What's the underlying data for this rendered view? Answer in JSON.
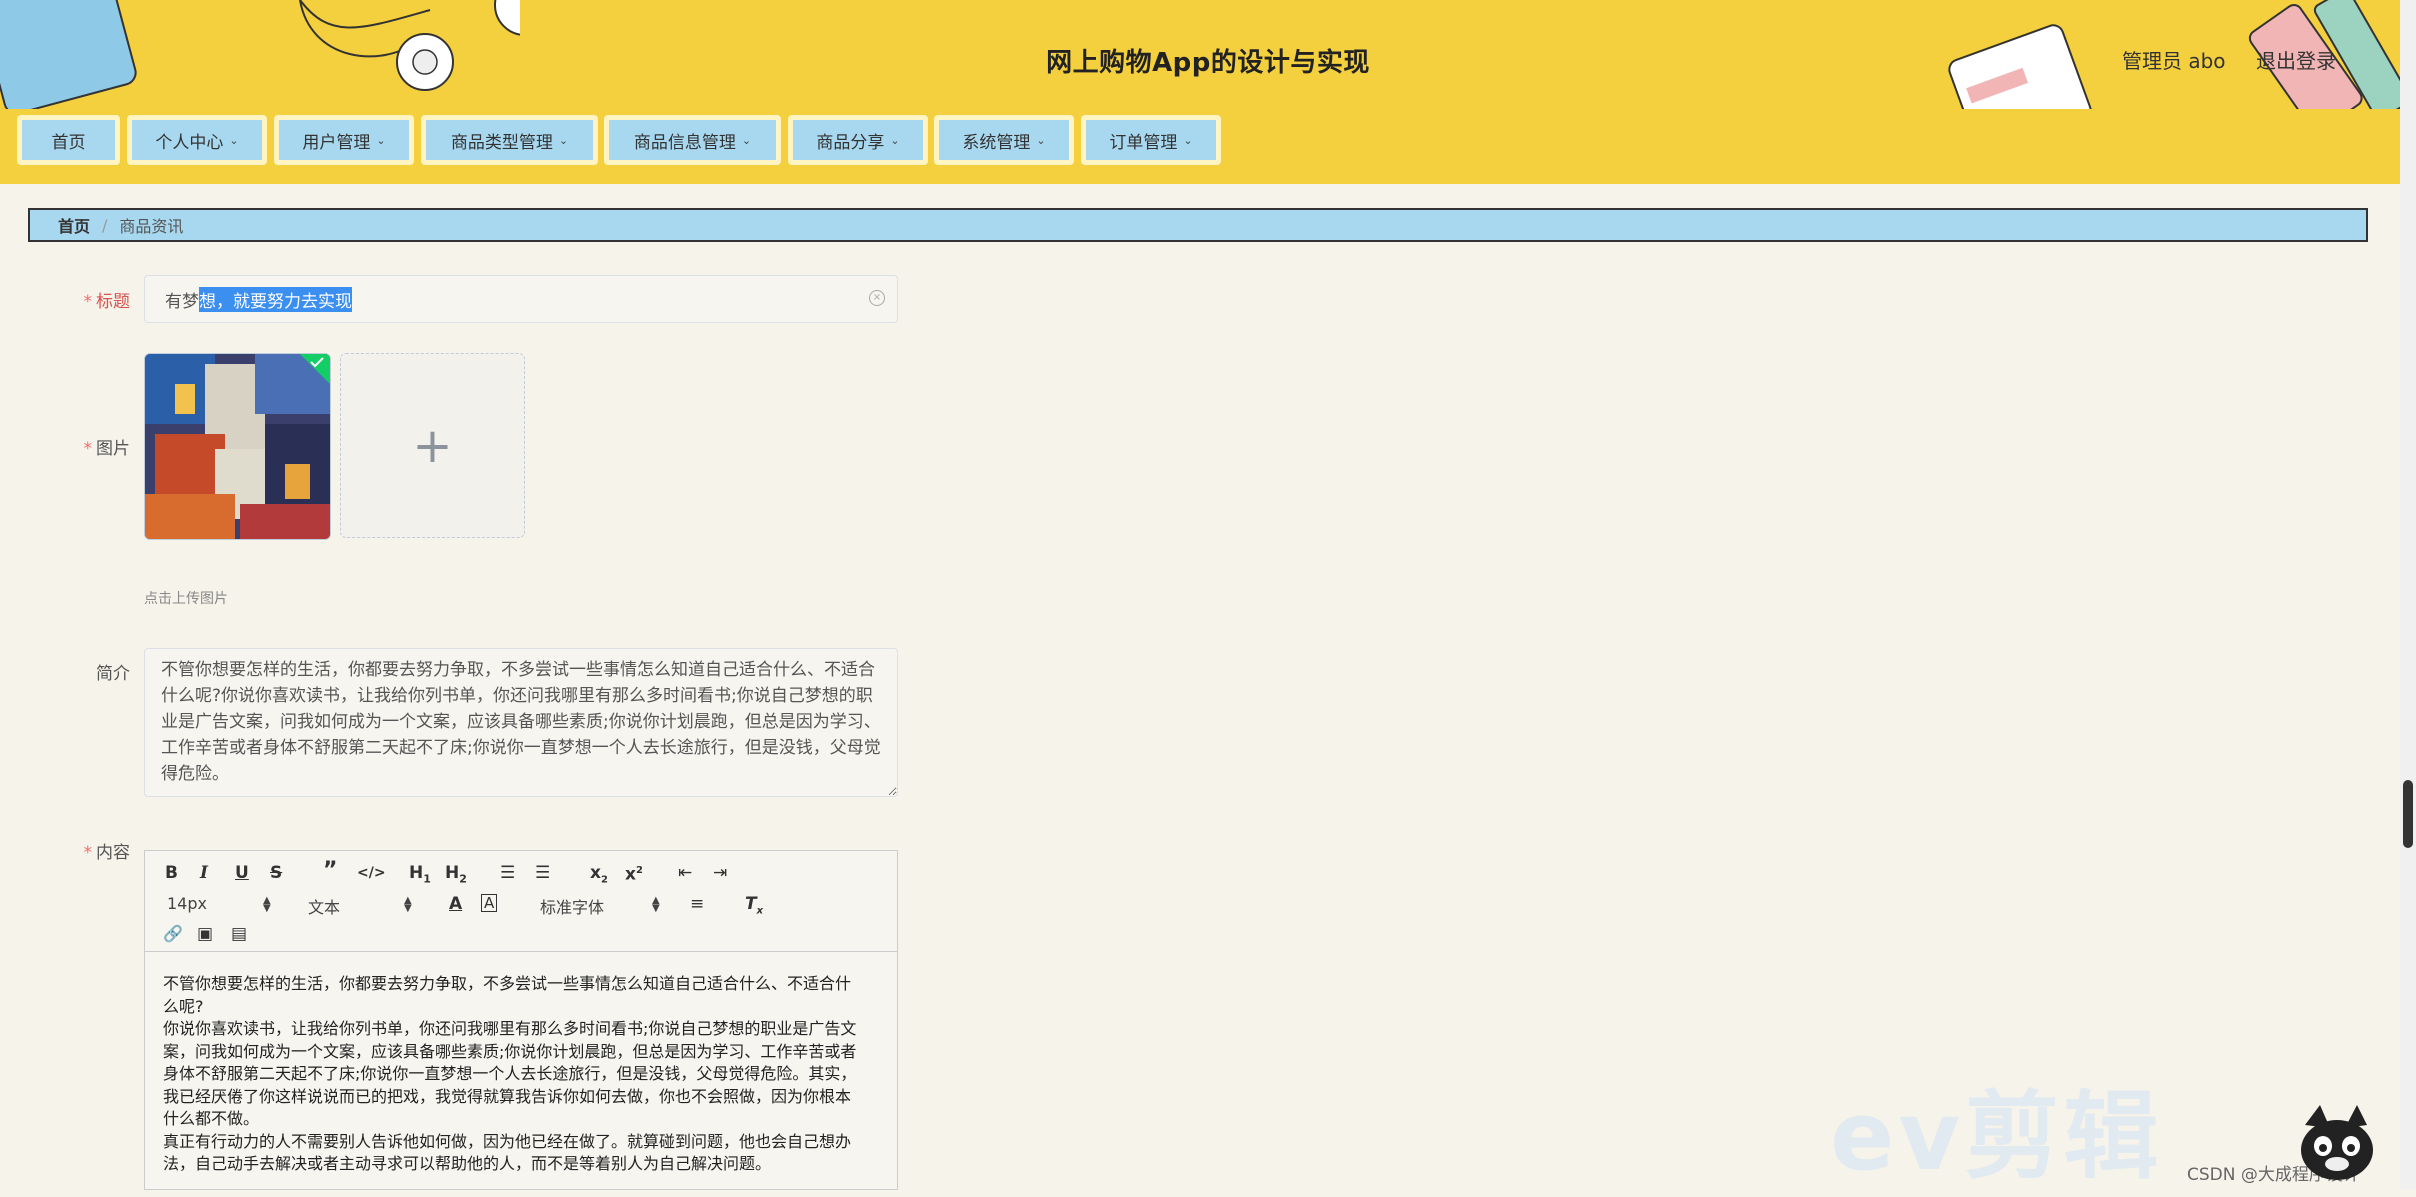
{
  "header": {
    "title": "网上购物App的设计与实现",
    "admin": "管理员 abo",
    "logout": "退出登录"
  },
  "nav": [
    {
      "label": "首页",
      "dropdown": false
    },
    {
      "label": "个人中心",
      "dropdown": true
    },
    {
      "label": "用户管理",
      "dropdown": true
    },
    {
      "label": "商品类型管理",
      "dropdown": true
    },
    {
      "label": "商品信息管理",
      "dropdown": true
    },
    {
      "label": "商品分享",
      "dropdown": true
    },
    {
      "label": "系统管理",
      "dropdown": true
    },
    {
      "label": "订单管理",
      "dropdown": true
    }
  ],
  "breadcrumb": {
    "home": "首页",
    "separator": "/",
    "current": "商品资讯"
  },
  "form": {
    "title_label": "标题",
    "title_value_plain": "有梦",
    "title_value_selected": "想，就要努力去实现",
    "image_label": "图片",
    "upload_plus": "+",
    "upload_tip": "点击上传图片",
    "intro_label": "简介",
    "intro_value": "不管你想要怎样的生活，你都要去努力争取，不多尝试一些事情怎么知道自己适合什么、不适合什么呢?你说你喜欢读书，让我给你列书单，你还问我哪里有那么多时间看书;你说自己梦想的职业是广告文案，问我如何成为一个文案，应该具备哪些素质;你说你计划晨跑，但总是因为学习、工作辛苦或者身体不舒服第二天起不了床;你说你一直梦想一个人去长途旅行，但是没钱，父母觉得危险。",
    "content_label": "内容"
  },
  "editor": {
    "font_size": "14px",
    "block_type": "文本",
    "font_family": "标准字体",
    "toolbar_icons": [
      "bold-icon",
      "italic-icon",
      "underline-icon",
      "strike-icon",
      "blockquote-icon",
      "code-block-icon",
      "h1-icon",
      "h2-icon",
      "ordered-list-icon",
      "bullet-list-icon",
      "subscript-icon",
      "superscript-icon",
      "outdent-icon",
      "indent-icon",
      "font-color-icon",
      "background-color-icon",
      "align-icon",
      "clean-format-icon",
      "link-icon",
      "image-icon",
      "video-icon"
    ],
    "content_lines": [
      "不管你想要怎样的生活，你都要去努力争取，不多尝试一些事情怎么知道自己适合什么、不适合什",
      "么呢?",
      "你说你喜欢读书，让我给你列书单，你还问我哪里有那么多时间看书;你说自己梦想的职业是广告文",
      "案，问我如何成为一个文案，应该具备哪些素质;你说你计划晨跑，但总是因为学习、工作辛苦或者",
      "身体不舒服第二天起不了床;你说你一直梦想一个人去长途旅行，但是没钱，父母觉得危险。其实，",
      "我已经厌倦了你这样说说而已的把戏，我觉得就算我告诉你如何去做，你也不会照做，因为你根本",
      "什么都不做。",
      "真正有行动力的人不需要别人告诉他如何做，因为他已经在做了。就算碰到问题，他也会自己想办",
      "法，自己动手去解决或者主动寻求可以帮助他的人，而不是等着别人为自己解决问题。"
    ]
  },
  "overlay": {
    "watermark": "ev剪辑",
    "csdn": "CSDN @大成程序设计"
  },
  "colors": {
    "header_bg": "#f4d03f",
    "nav_item_bg": "#a8d8f0",
    "page_bg": "#f6f3ea",
    "required_star": "#f56c6c",
    "selection": "#3b8ff0"
  }
}
